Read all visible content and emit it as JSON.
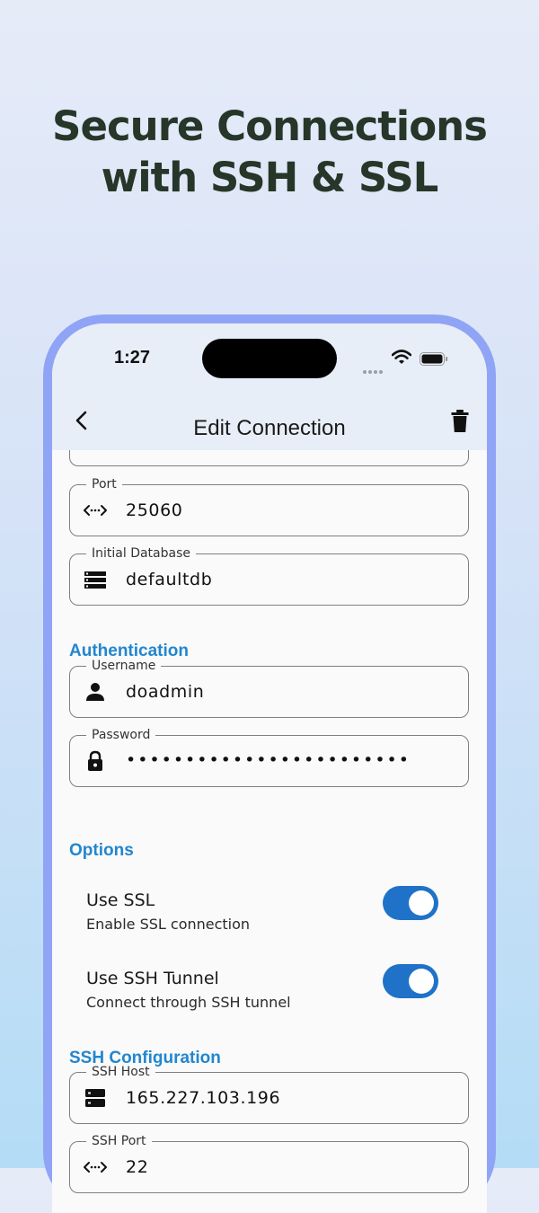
{
  "headline": {
    "line1": "Secure Connections",
    "line2": "with SSH & SSL"
  },
  "status_bar": {
    "time": "1:27"
  },
  "nav": {
    "title": "Edit Connection",
    "back_icon": "chevron-left-icon",
    "delete_icon": "trash-icon"
  },
  "fields": {
    "port": {
      "label": "Port",
      "value": "25060",
      "icon": "code-arrows-icon"
    },
    "database": {
      "label": "Initial Database",
      "value": "defaultdb",
      "icon": "list-icon"
    },
    "username": {
      "label": "Username",
      "value": "doadmin",
      "icon": "person-icon"
    },
    "password": {
      "label": "Password",
      "value": "••••••••••••••••••••••••",
      "icon": "lock-icon"
    },
    "ssh_host": {
      "label": "SSH Host",
      "value": "165.227.103.196",
      "icon": "server-icon"
    },
    "ssh_port": {
      "label": "SSH Port",
      "value": "22",
      "icon": "code-arrows-icon"
    }
  },
  "sections": {
    "authentication": "Authentication",
    "options": "Options",
    "ssh": "SSH Configuration"
  },
  "options": {
    "ssl": {
      "title": "Use SSL",
      "subtitle": "Enable SSL connection",
      "enabled": true
    },
    "ssh_tunnel": {
      "title": "Use SSH Tunnel",
      "subtitle": "Connect through SSH tunnel",
      "enabled": true
    }
  },
  "colors": {
    "accent": "#2286cf",
    "toggle_on": "#1f72c8",
    "headline": "#263629",
    "phone_frame": "#90a4f6"
  }
}
